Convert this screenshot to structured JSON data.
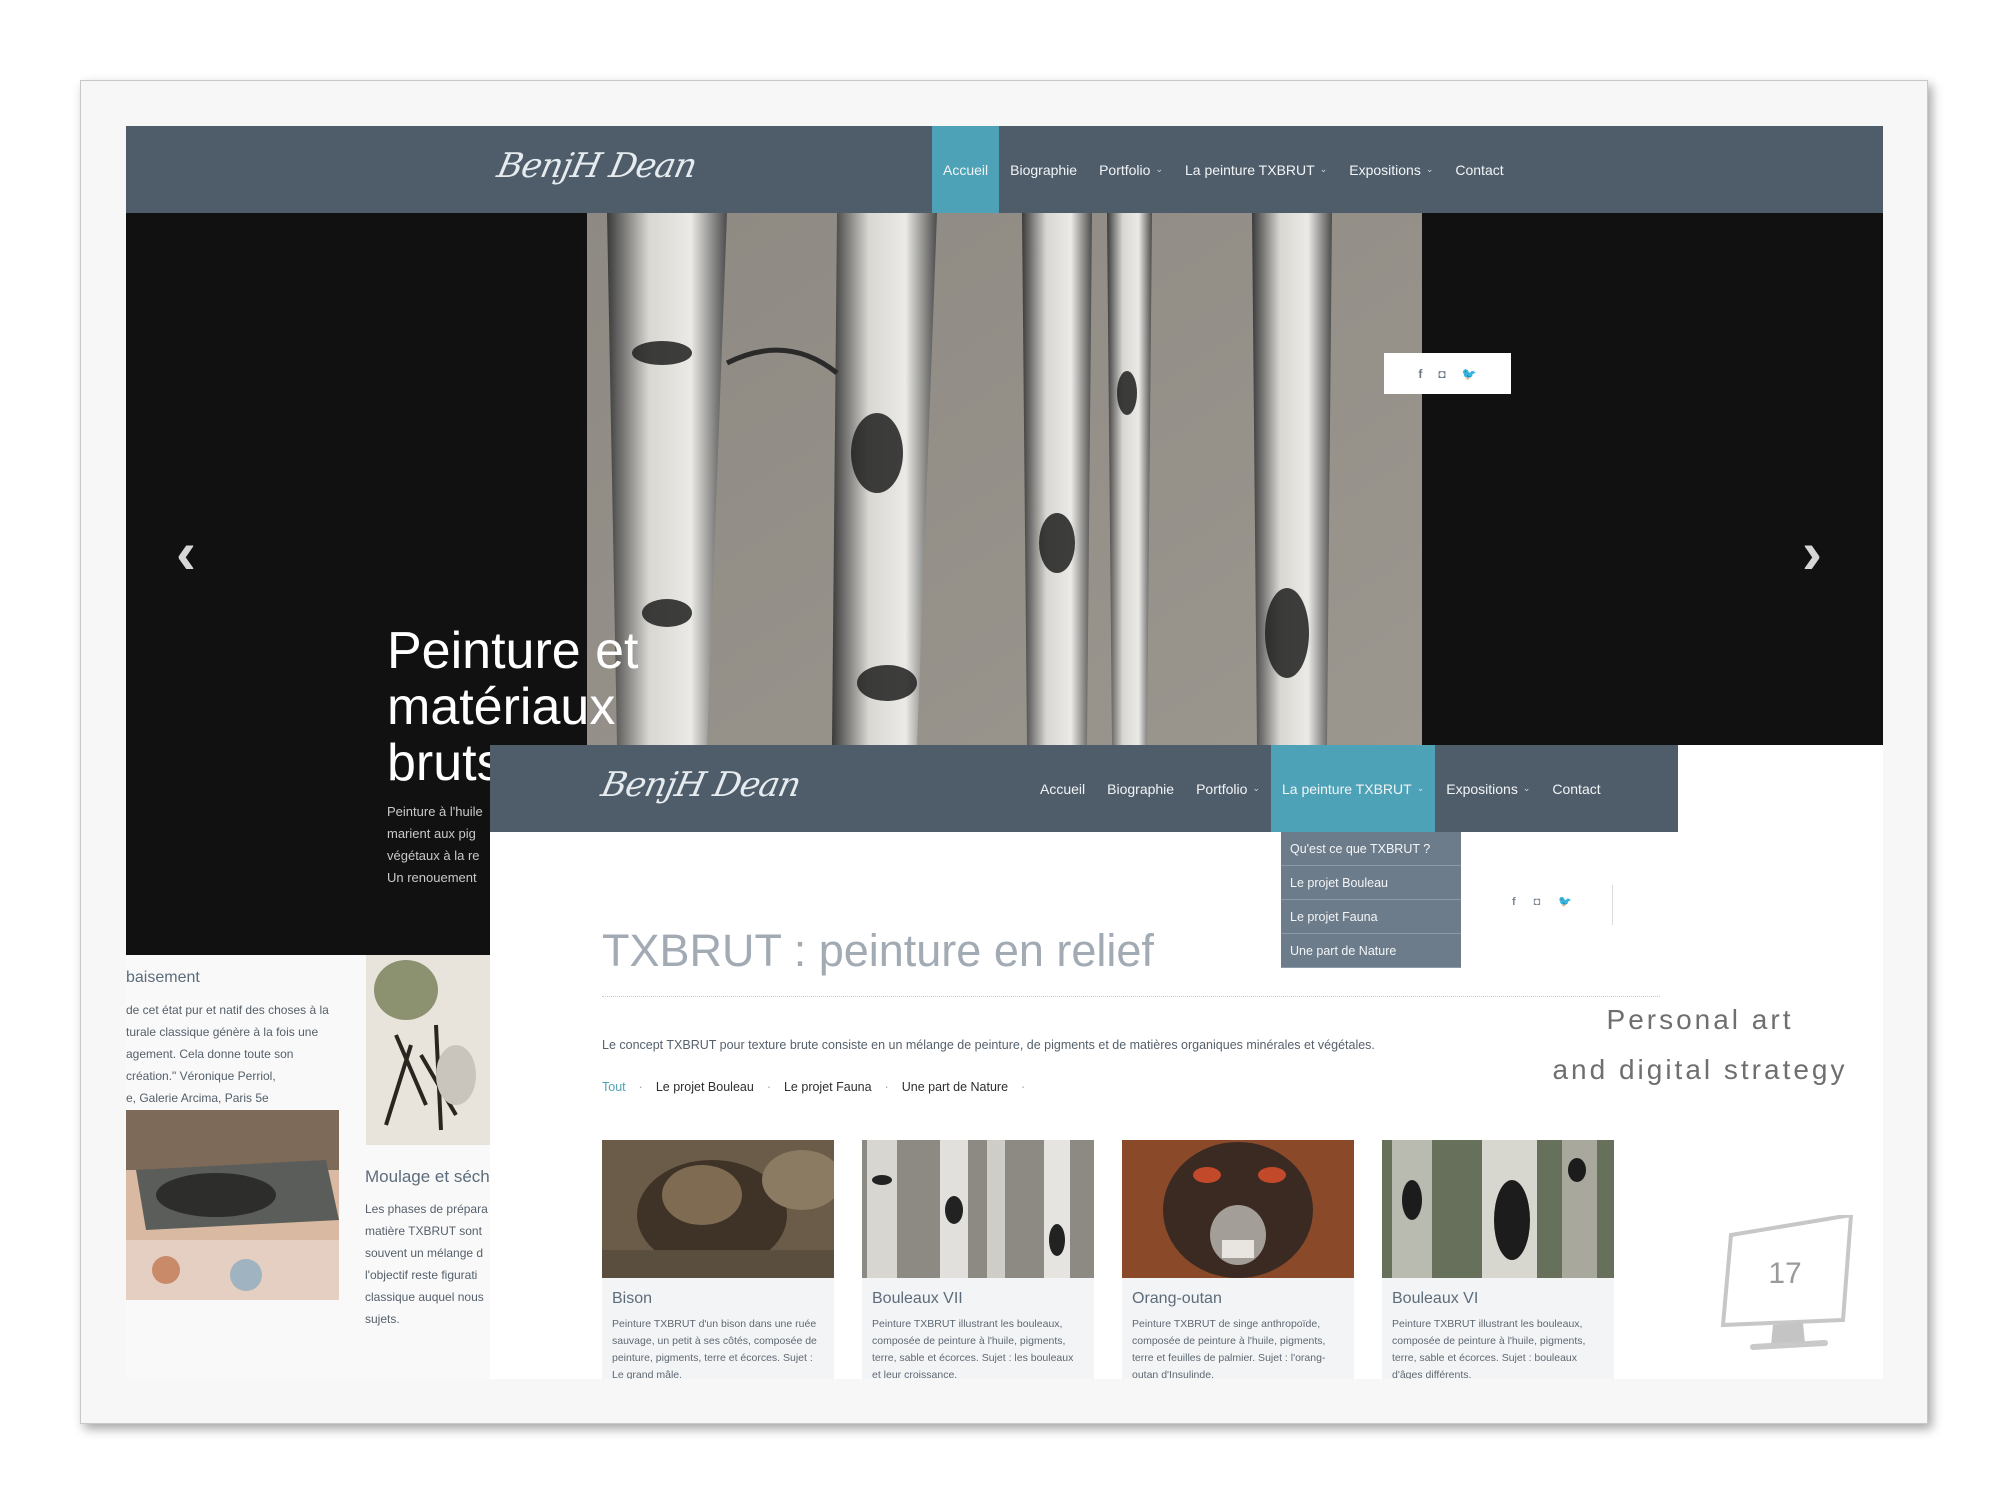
{
  "back_site": {
    "logo": "BenjH Dean",
    "nav": [
      {
        "label": "Accueil",
        "active": true
      },
      {
        "label": "Biographie"
      },
      {
        "label": "Portfolio",
        "caret": "⌄"
      },
      {
        "label": "La peinture TXBRUT",
        "caret": "⌄"
      },
      {
        "label": "Expositions",
        "caret": "⌄"
      },
      {
        "label": "Contact"
      }
    ],
    "hero": {
      "title_line1": "Peinture et",
      "title_line2": "matériaux",
      "title_line3": "bruts",
      "text_lines": [
        "Peinture à l'huile",
        "marient aux pig",
        "végétaux à la re",
        "Un renouement"
      ],
      "prev_icon": "‹",
      "next_icon": "›"
    },
    "social": [
      "f",
      "◘",
      "🐦"
    ],
    "lower": {
      "section_title": "baisement",
      "quote_lines": [
        "de cet état pur et natif des choses à la",
        "turale classique génère à la fois une",
        "agement. Cela donne toute son",
        "création.\" Véronique Perriol,",
        "e, Galerie Arcima, Paris 5e"
      ],
      "moulage_title": "Moulage et séch",
      "moulage_lines": [
        "Les phases de prépara",
        "matière TXBRUT sont",
        "souvent un mélange d",
        "l'objectif reste figurati",
        "classique auquel nous",
        "sujets."
      ]
    }
  },
  "front_site": {
    "logo": "BenjH Dean",
    "nav": [
      {
        "label": "Accueil"
      },
      {
        "label": "Biographie"
      },
      {
        "label": "Portfolio",
        "caret": "⌄"
      },
      {
        "label": "La peinture TXBRUT",
        "caret": "⌄",
        "active": true
      },
      {
        "label": "Expositions",
        "caret": "⌄"
      },
      {
        "label": "Contact"
      }
    ],
    "dropdown": [
      "Qu'est ce que TXBRUT ?",
      "Le projet Bouleau",
      "Le projet Fauna",
      "Une part de Nature"
    ],
    "social": [
      "f",
      "◘",
      "🐦"
    ],
    "title": "TXBRUT : peinture en relief",
    "concept": "Le concept TXBRUT pour texture brute consiste en un mélange de peinture, de pigments et de matières organiques minérales et végétales.",
    "filters": [
      {
        "label": "Tout",
        "active": true
      },
      {
        "label": "Le projet Bouleau"
      },
      {
        "label": "Le projet Fauna"
      },
      {
        "label": "Une part de Nature"
      }
    ],
    "filter_sep": "·",
    "cards": [
      {
        "title": "Bison",
        "text": "Peinture TXBRUT d'un bison dans une ruée sauvage, un petit à ses côtés, composée de peinture, pigments, terre et écorces. Sujet : Le grand mâle."
      },
      {
        "title": "Bouleaux VII",
        "text": "Peinture TXBRUT illustrant les bouleaux, composée de peinture à l'huile, pigments, terre, sable et écorces. Sujet : les bouleaux et leur croissance."
      },
      {
        "title": "Orang-outan",
        "text": "Peinture TXBRUT de singe anthropoïde, composée de peinture à l'huile, pigments, terre et feuilles de palmier. Sujet : l'orang-outan d'Insulinde."
      },
      {
        "title": "Bouleaux VI",
        "text": "Peinture TXBRUT illustrant les bouleaux, composée de peinture à l'huile, pigments, terre, sable et écorces. Sujet : bouleaux d'âges différents."
      }
    ]
  },
  "tagline_line1": "Personal art",
  "tagline_line2": "and digital strategy",
  "slide_number": "17",
  "colors": {
    "nav_bg": "#4f5d6b",
    "accent": "#4ea2b7",
    "dropdown_bg": "#6d7c8b"
  }
}
